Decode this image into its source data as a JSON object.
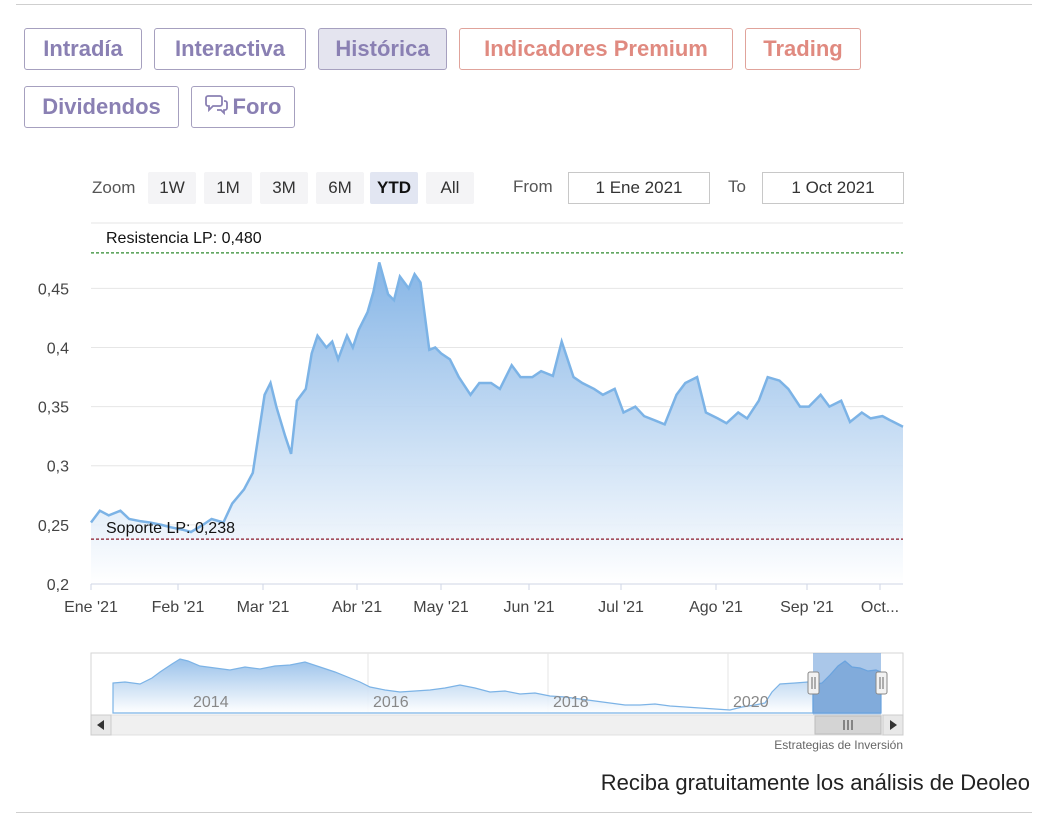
{
  "tabs": [
    {
      "label": "Intradía",
      "state": "normal"
    },
    {
      "label": "Interactiva",
      "state": "normal"
    },
    {
      "label": "Histórica",
      "state": "active"
    },
    {
      "label": "Indicadores Premium",
      "state": "premium"
    },
    {
      "label": "Trading",
      "state": "premium"
    },
    {
      "label": "Dividendos",
      "state": "normal"
    },
    {
      "label": "Foro",
      "state": "normal",
      "icon": "chat-bubbles-icon"
    }
  ],
  "range_selector": {
    "zoom_label": "Zoom",
    "buttons": [
      "1W",
      "1M",
      "3M",
      "6M",
      "YTD",
      "All"
    ],
    "selected": "YTD",
    "from_label": "From",
    "from_value": "1 Ene 2021",
    "to_label": "To",
    "to_value": "1 Oct 2021"
  },
  "colors": {
    "series_line": "#7cb3e6",
    "area_top": "#7fb1e5",
    "resistance_line": "#2d8a2d",
    "support_line": "#8b1a2b",
    "tab_text": "#8a80b3",
    "premium_text": "#e08a80"
  },
  "chart_data": {
    "type": "area",
    "title": "",
    "xlabel": "",
    "ylabel": "",
    "y_ticks": [
      "0,2",
      "0,25",
      "0,3",
      "0,35",
      "0,4",
      "0,45"
    ],
    "x_ticks": [
      "Ene '21",
      "Feb '21",
      "Mar '21",
      "Abr '21",
      "May '21",
      "Jun '21",
      "Jul '21",
      "Ago '21",
      "Sep '21",
      "Oct..."
    ],
    "ylim": [
      0.2,
      0.48
    ],
    "x_range": [
      "2021-01-01",
      "2021-10-04"
    ],
    "grid": true,
    "series": [
      {
        "x": [
          "2021-01-01",
          "2021-01-04",
          "2021-01-07",
          "2021-01-11",
          "2021-01-14",
          "2021-01-18",
          "2021-01-21",
          "2021-01-25",
          "2021-01-28",
          "2021-02-01",
          "2021-02-04",
          "2021-02-08",
          "2021-02-11",
          "2021-02-15",
          "2021-02-18",
          "2021-02-22",
          "2021-02-25",
          "2021-03-01",
          "2021-03-03",
          "2021-03-05",
          "2021-03-08",
          "2021-03-10",
          "2021-03-12",
          "2021-03-15",
          "2021-03-17",
          "2021-03-19",
          "2021-03-22",
          "2021-03-24",
          "2021-03-26",
          "2021-03-29",
          "2021-03-31",
          "2021-04-02",
          "2021-04-05",
          "2021-04-07",
          "2021-04-09",
          "2021-04-12",
          "2021-04-14",
          "2021-04-16",
          "2021-04-19",
          "2021-04-21",
          "2021-04-23",
          "2021-04-26",
          "2021-04-28",
          "2021-04-30",
          "2021-05-03",
          "2021-05-06",
          "2021-05-10",
          "2021-05-13",
          "2021-05-17",
          "2021-05-20",
          "2021-05-24",
          "2021-05-27",
          "2021-05-31",
          "2021-06-03",
          "2021-06-07",
          "2021-06-10",
          "2021-06-14",
          "2021-06-17",
          "2021-06-21",
          "2021-06-24",
          "2021-06-28",
          "2021-07-01",
          "2021-07-05",
          "2021-07-08",
          "2021-07-12",
          "2021-07-15",
          "2021-07-19",
          "2021-07-22",
          "2021-07-26",
          "2021-07-29",
          "2021-08-02",
          "2021-08-05",
          "2021-08-09",
          "2021-08-12",
          "2021-08-16",
          "2021-08-19",
          "2021-08-23",
          "2021-08-26",
          "2021-08-30",
          "2021-09-02",
          "2021-09-06",
          "2021-09-09",
          "2021-09-13",
          "2021-09-16",
          "2021-09-20",
          "2021-09-23",
          "2021-09-27",
          "2021-09-30",
          "2021-10-04"
        ],
        "y": [
          0.252,
          0.262,
          0.258,
          0.262,
          0.255,
          0.253,
          0.252,
          0.25,
          0.248,
          0.246,
          0.244,
          0.25,
          0.255,
          0.252,
          0.268,
          0.28,
          0.294,
          0.36,
          0.37,
          0.35,
          0.325,
          0.31,
          0.355,
          0.365,
          0.395,
          0.41,
          0.4,
          0.405,
          0.39,
          0.41,
          0.4,
          0.415,
          0.43,
          0.447,
          0.472,
          0.445,
          0.44,
          0.46,
          0.45,
          0.462,
          0.455,
          0.398,
          0.4,
          0.395,
          0.39,
          0.375,
          0.36,
          0.37,
          0.37,
          0.365,
          0.385,
          0.375,
          0.375,
          0.38,
          0.376,
          0.405,
          0.375,
          0.37,
          0.365,
          0.36,
          0.365,
          0.345,
          0.35,
          0.342,
          0.338,
          0.335,
          0.36,
          0.37,
          0.375,
          0.345,
          0.34,
          0.336,
          0.345,
          0.34,
          0.355,
          0.375,
          0.372,
          0.365,
          0.35,
          0.35,
          0.36,
          0.35,
          0.355,
          0.337,
          0.345,
          0.34,
          0.342,
          0.338,
          0.333
        ]
      }
    ],
    "annotations": [
      {
        "label": "Resistencia LP: 0,480",
        "y": 0.48,
        "style": "dashed-green"
      },
      {
        "label": "Soporte LP: 0,238",
        "y": 0.238,
        "style": "dashed-dark-red"
      }
    ],
    "navigator": {
      "x_ticks": [
        "2014",
        "2016",
        "2018",
        "2020"
      ]
    }
  },
  "credits": "Estrategias de Inversión",
  "promo_text": "Reciba gratuitamente los análisis de Deoleo"
}
